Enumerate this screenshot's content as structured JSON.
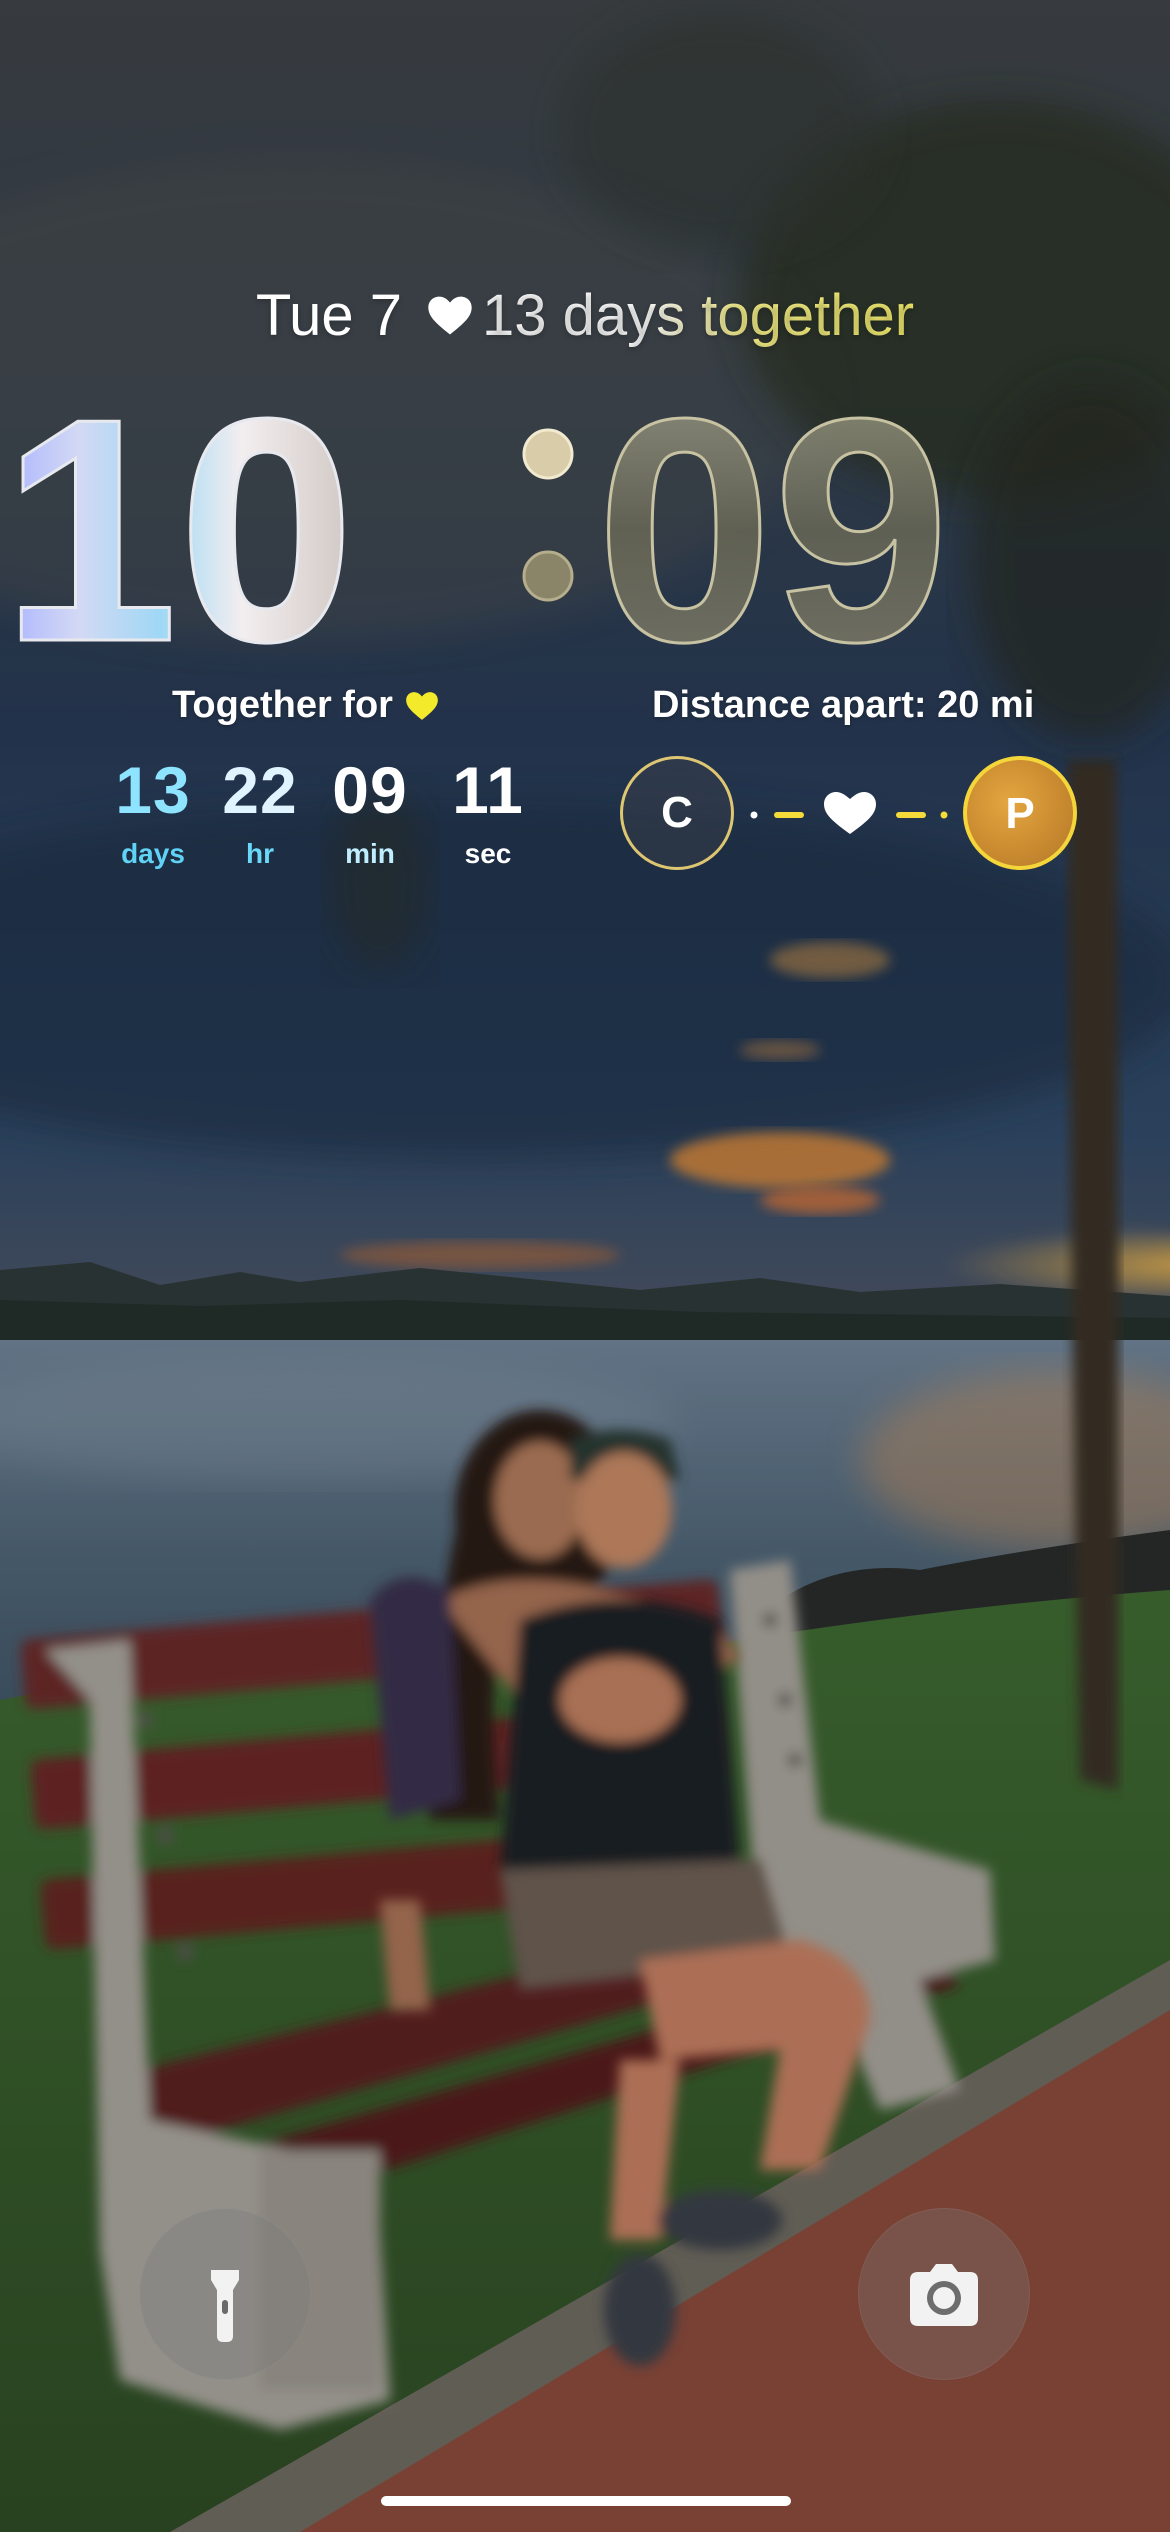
{
  "lock_screen": {
    "date": "Tue 7",
    "together_summary": "13 days together",
    "time": {
      "hours": "10",
      "minutes": "09"
    }
  },
  "together_widget": {
    "title": "Together for",
    "counters": [
      {
        "value": "13",
        "unit": "days"
      },
      {
        "value": "22",
        "unit": "hr"
      },
      {
        "value": "09",
        "unit": "min"
      },
      {
        "value": "11",
        "unit": "sec"
      }
    ]
  },
  "distance_widget": {
    "title": "Distance apart: 20 mi",
    "person_left_initial": "C",
    "person_right_initial": "P"
  },
  "quick_actions": {
    "left_icon": "flashlight-icon",
    "right_icon": "camera-icon"
  },
  "colors": {
    "accent_yellow": "#f4d53a",
    "counter_cyan": "#5fd2f6",
    "heart_white": "#ffffff"
  }
}
